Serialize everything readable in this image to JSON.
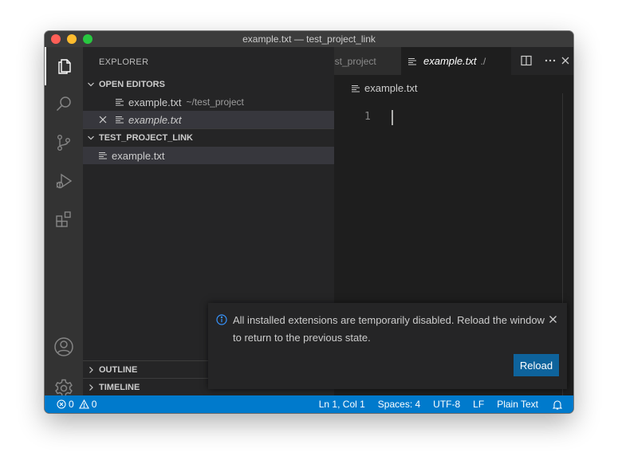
{
  "window": {
    "title": "example.txt — test_project_link"
  },
  "activity_bar": {
    "items": [
      "files-icon",
      "search-icon",
      "source-control-icon",
      "run-debug-icon",
      "extensions-icon"
    ],
    "bottom": [
      "account-icon",
      "manage-gear-icon"
    ]
  },
  "sidebar": {
    "title": "EXPLORER",
    "open_editors": {
      "header": "OPEN EDITORS",
      "items": [
        {
          "label": "example.txt",
          "description": "~/test_project"
        },
        {
          "label": "example.txt",
          "description": ""
        }
      ]
    },
    "folder": {
      "header": "TEST_PROJECT_LINK",
      "items": [
        {
          "label": "example.txt"
        }
      ]
    },
    "outline_header": "OUTLINE",
    "timeline_header": "TIMELINE"
  },
  "editor": {
    "tabs": [
      {
        "label": "est_project",
        "active": false
      },
      {
        "label": "example.txt",
        "description": "./",
        "active": true
      }
    ],
    "breadcrumb": "example.txt",
    "line_numbers": [
      "1"
    ]
  },
  "notification": {
    "message": "All installed extensions are temporarily disabled. Reload the window to return to the previous state.",
    "button": "Reload"
  },
  "status_bar": {
    "errors": "0",
    "warnings": "0",
    "position": "Ln 1, Col 1",
    "indent": "Spaces: 4",
    "encoding": "UTF-8",
    "eol": "LF",
    "language": "Plain Text"
  },
  "colors": {
    "status_bar": "#007acc",
    "reload_button": "#0e639c",
    "info_icon": "#3794ff"
  }
}
